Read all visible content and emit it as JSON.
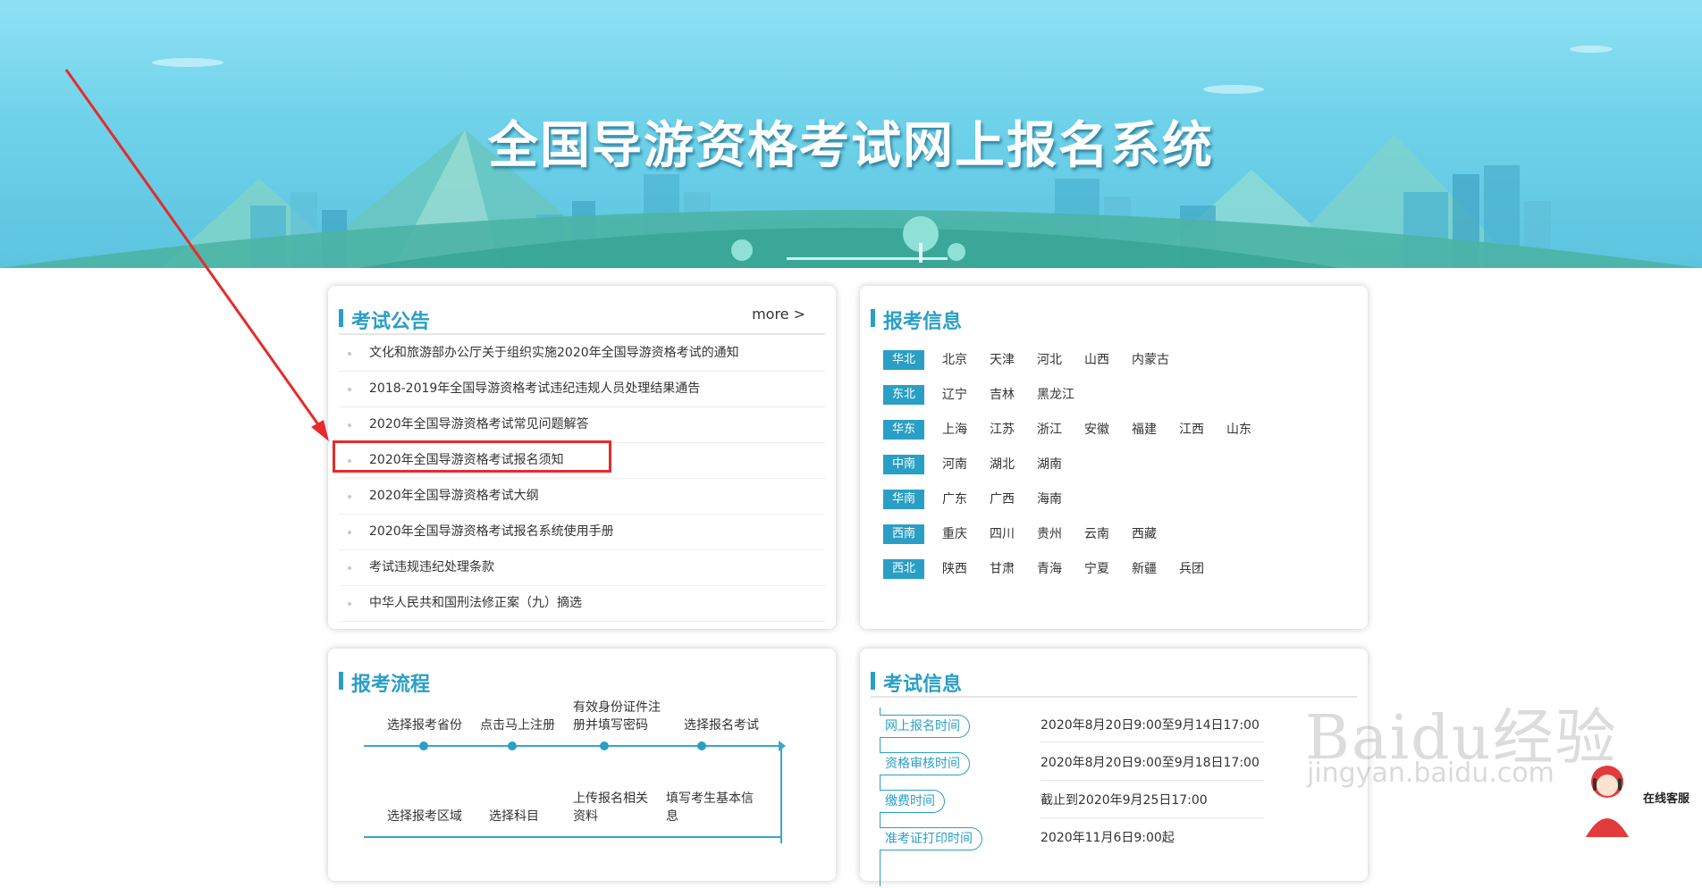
{
  "banner": {
    "title": "全国导游资格考试网上报名系统"
  },
  "notices": {
    "title": "考试公告",
    "more_label": "more >",
    "items": [
      {
        "text": "文化和旅游部办公厅关于组织实施2020年全国导游资格考试的通知"
      },
      {
        "text": "2018-2019年全国导游资格考试违纪违规人员处理结果通告"
      },
      {
        "text": "2020年全国导游资格考试常见问题解答"
      },
      {
        "text": "2020年全国导游资格考试报名须知"
      },
      {
        "text": "2020年全国导游资格考试大纲"
      },
      {
        "text": "2020年全国导游资格考试报名系统使用手册"
      },
      {
        "text": "考试违规违纪处理条款"
      },
      {
        "text": "中华人民共和国刑法修正案（九）摘选"
      }
    ]
  },
  "regions": {
    "title": "报考信息",
    "rows": [
      {
        "name": "华北",
        "provinces": [
          "北京",
          "天津",
          "河北",
          "山西",
          "内蒙古"
        ]
      },
      {
        "name": "东北",
        "provinces": [
          "辽宁",
          "吉林",
          "黑龙江"
        ]
      },
      {
        "name": "华东",
        "provinces": [
          "上海",
          "江苏",
          "浙江",
          "安徽",
          "福建",
          "江西",
          "山东"
        ]
      },
      {
        "name": "中南",
        "provinces": [
          "河南",
          "湖北",
          "湖南"
        ]
      },
      {
        "name": "华南",
        "provinces": [
          "广东",
          "广西",
          "海南"
        ]
      },
      {
        "name": "西南",
        "provinces": [
          "重庆",
          "四川",
          "贵州",
          "云南",
          "西藏"
        ]
      },
      {
        "name": "西北",
        "provinces": [
          "陕西",
          "甘肃",
          "青海",
          "宁夏",
          "新疆",
          "兵团"
        ]
      }
    ]
  },
  "process": {
    "title": "报考流程",
    "row1": [
      "选择报考省份",
      "点击马上注册",
      "有效身份证件注册并填写密码",
      "选择报名考试"
    ],
    "row2": [
      "选择报考区域",
      "选择科目",
      "上传报名相关资料",
      "填写考生基本信息"
    ]
  },
  "exam_info": {
    "title": "考试信息",
    "items": [
      {
        "label": "网上报名时间",
        "value": "2020年8月20日9:00至9月14日17:00"
      },
      {
        "label": "资格审核时间",
        "value": "2020年8月20日9:00至9月18日17:00"
      },
      {
        "label": "缴费时间",
        "value": "截止到2020年9月25日17:00"
      },
      {
        "label": "准考证打印时间",
        "value": "2020年11月6日9:00起"
      }
    ]
  },
  "watermark": {
    "brand": "Baidu经验",
    "url": "jingyan.baidu.com"
  },
  "service": {
    "label": "在线客服"
  }
}
